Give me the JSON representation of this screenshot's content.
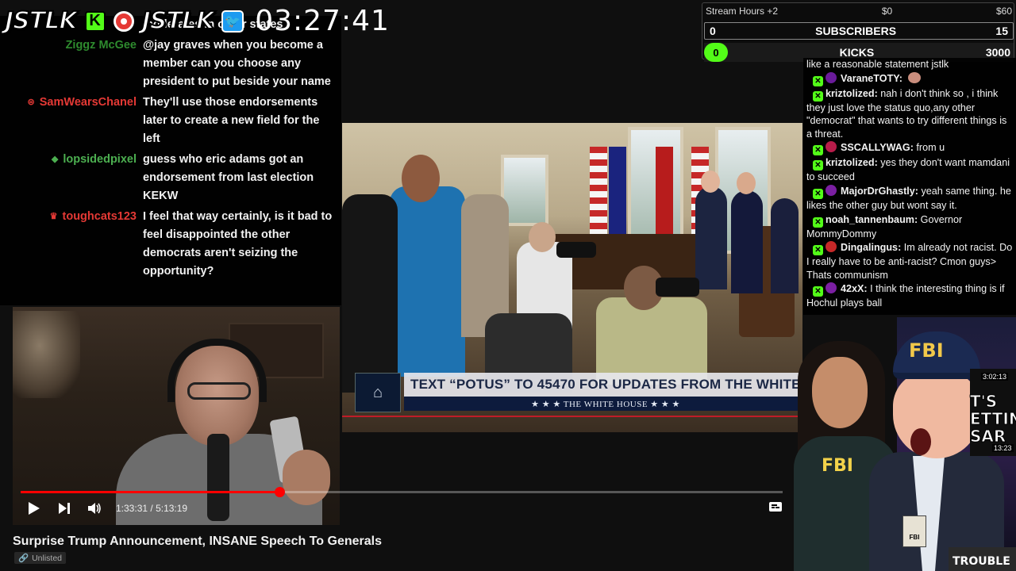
{
  "overlay": {
    "brand_name": "JSTLK",
    "brand_name_2": "JSTLK",
    "kick_letter": "K",
    "clock": "03:27:41"
  },
  "left_chat": [
    {
      "name": "",
      "name_color": "#aaaaaa",
      "icon": "",
      "text": "moderates in other states"
    },
    {
      "name": "Ziggz McGee",
      "name_color": "#2e8b2e",
      "icon": "",
      "text": "@jay graves when you become a member can you choose any president to put beside your name"
    },
    {
      "name": "SamWearsChanel",
      "name_color": "#e53935",
      "icon": "money-icon",
      "text": "They'll use those endorsements later to create a new field for the left"
    },
    {
      "name": "lopsidedpixel",
      "name_color": "#4caf50",
      "icon": "gem-icon",
      "text": "guess who eric adams got an endorsement from last election KEKW"
    },
    {
      "name": "toughcats123",
      "name_color": "#e53935",
      "icon": "crown-icon",
      "text": "I feel that way certainly, is it bad to feel disappointed the other democrats aren't seizing the opportunity?"
    }
  ],
  "video": {
    "lower_third_text": "TEXT “POTUS” TO 45470 FOR UPDATES FROM THE WHITE",
    "lower_third_sub": "★ ★ ★   THE WHITE HOUSE   ★ ★ ★",
    "progress": 0.34
  },
  "player": {
    "current_time": "1:33:31",
    "separator": " / ",
    "duration": "5:13:19"
  },
  "page": {
    "title": "Surprise Trump Announcement, INSANE Speech To Generals",
    "visibility": "Unlisted"
  },
  "stats": {
    "stream_hours": "Stream Hours +2",
    "money_min": "$0",
    "money_max": "$60",
    "subs_current": "0",
    "subs_label": "SUBSCRIBERS",
    "subs_goal": "15",
    "kicks_current": "0",
    "kicks_label": "KICKS",
    "kicks_goal": "3000"
  },
  "right_chat": [
    {
      "name": "",
      "dot": "",
      "text": "like a reasonable statement jstlk",
      "badge": false
    },
    {
      "name": "VaraneTOTY:",
      "dot": "#6a1b9a",
      "text": "",
      "badge": true,
      "emote": true
    },
    {
      "name": "kriztolized:",
      "dot": "",
      "text": "nah i don't think so , i think they just love the status quo,any other \"democrat\" that wants to try different things is a threat.",
      "badge": true
    },
    {
      "name": "SSCALLYWAG:",
      "dot": "#b71c4a",
      "text": "from u",
      "badge": true
    },
    {
      "name": "kriztolized:",
      "dot": "",
      "text": "yes they don't want mamdani to succeed",
      "badge": true
    },
    {
      "name": "MajorDrGhastly:",
      "dot": "#7b1fa2",
      "text": "yeah same thing. he likes the other guy but wont say it.",
      "badge": true
    },
    {
      "name": "noah_tannenbaum:",
      "dot": "",
      "text": "Governor MommyDommy",
      "badge": true
    },
    {
      "name": "Dingalingus:",
      "dot": "#c62828",
      "text": "Im already not racist. Do I really have to be anti-racist? Cmon guys> Thats communism",
      "badge": true
    },
    {
      "name": "42xX:",
      "dot": "#7b1fa2",
      "text": "I think the interesting thing is if Hochul plays ball",
      "badge": true
    }
  ],
  "sidebar": {
    "fbi_cap": "FBI",
    "fbi_jacket": "FBI",
    "thumb_text": "T'S ETTING SAR",
    "thumb_time_1": "3:02:13",
    "thumb_time_2": "13:23",
    "bottom_text": "TROUBLE",
    "badge_text": "FBI"
  },
  "colors": {
    "kick_green": "#53fc18",
    "youtube_red": "#ff0000",
    "whitehouse_navy": "#0d1b3d"
  }
}
